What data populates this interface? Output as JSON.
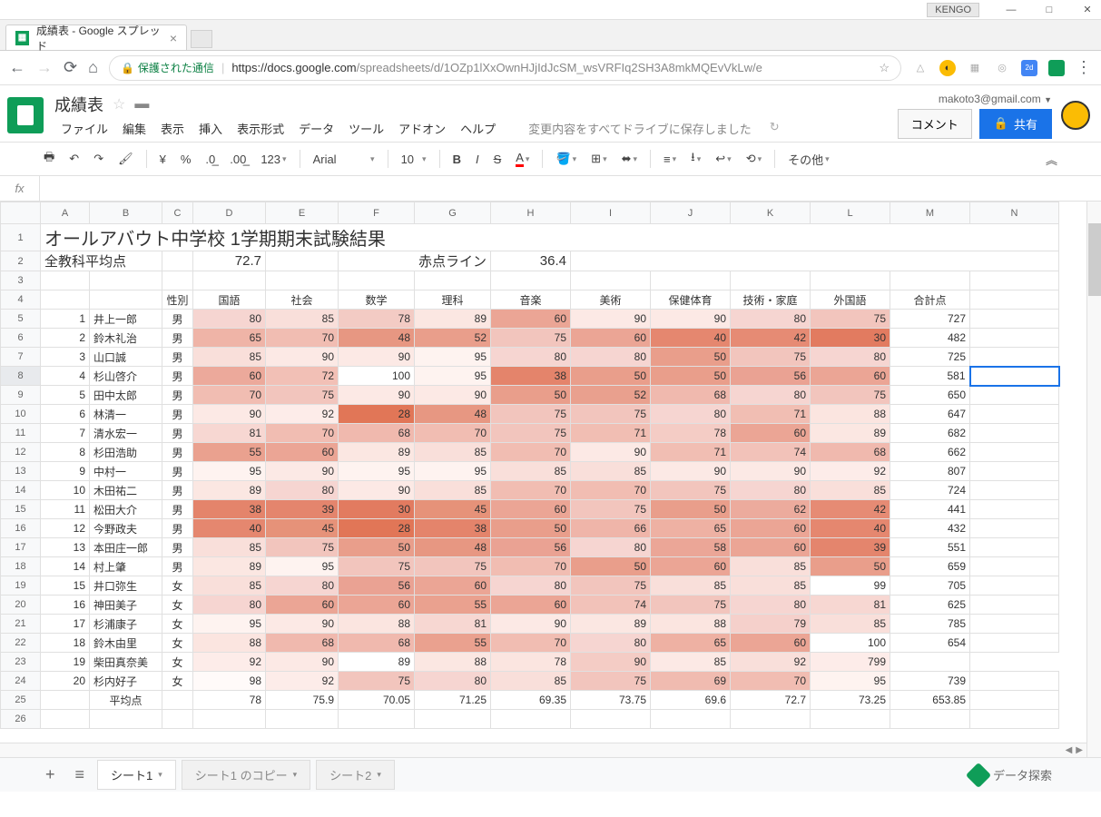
{
  "window": {
    "user": "KENGO"
  },
  "browser": {
    "tab_title": "成績表 - Google スプレッド",
    "secure_label": "保護された通信",
    "url_host": "https://docs.google.com",
    "url_path": "/spreadsheets/d/1OZp1lXxOwnHJjIdJcSM_wsVRFIq2SH3A8mkMQEvVkLw/e"
  },
  "doc": {
    "title": "成績表",
    "menus": [
      "ファイル",
      "編集",
      "表示",
      "挿入",
      "表示形式",
      "データ",
      "ツール",
      "アドオン",
      "ヘルプ"
    ],
    "save_status": "変更内容をすべてドライブに保存しました",
    "user_email": "makoto3@gmail.com",
    "comment_btn": "コメント",
    "share_btn": "共有"
  },
  "toolbar": {
    "font": "Arial",
    "size": "10",
    "other": "その他"
  },
  "sheet": {
    "main_title": "オールアバウト中学校 1学期期末試験結果",
    "avg_label": "全教科平均点",
    "avg_val": "72.7",
    "red_label": "赤点ライン",
    "red_val": "36.4",
    "gender_hdr": "性別",
    "cols": [
      "A",
      "B",
      "C",
      "D",
      "E",
      "F",
      "G",
      "H",
      "I",
      "J",
      "K",
      "L",
      "M",
      "N"
    ],
    "subjects": [
      "国語",
      "社会",
      "数学",
      "理科",
      "音楽",
      "美術",
      "保健体育",
      "技術・家庭",
      "外国語",
      "合計点"
    ],
    "avg_row_label": "平均点",
    "averages": [
      "78",
      "75.9",
      "70.05",
      "71.25",
      "69.35",
      "73.75",
      "69.6",
      "72.7",
      "73.25",
      "653.85"
    ],
    "rows": [
      {
        "n": 1,
        "name": "井上一郎",
        "g": "男",
        "s": [
          80,
          85,
          78,
          89,
          60,
          90,
          90,
          80,
          75,
          727
        ],
        "c": [
          "f6d5d1",
          "f9dfda",
          "f3cbc4",
          "fbe7e2",
          "eba595",
          "fce9e5",
          "fce9e5",
          "f6d5d1",
          "f2c5bd",
          ""
        ]
      },
      {
        "n": 2,
        "name": "鈴木礼治",
        "g": "男",
        "s": [
          65,
          70,
          48,
          52,
          75,
          60,
          40,
          42,
          30,
          482
        ],
        "c": [
          "efb4a7",
          "f1bdb2",
          "e79782",
          "e99e8b",
          "f2c5bd",
          "eba595",
          "e5876f",
          "e68b74",
          "e27b60",
          ""
        ]
      },
      {
        "n": 3,
        "name": "山口誠",
        "g": "男",
        "s": [
          85,
          90,
          90,
          95,
          80,
          80,
          50,
          75,
          80,
          725
        ],
        "c": [
          "f9dfda",
          "fce9e5",
          "fce9e5",
          "fef3f0",
          "f6d5d1",
          "f6d5d1",
          "e99e8b",
          "f2c5bd",
          "f6d5d1",
          ""
        ]
      },
      {
        "n": 4,
        "name": "杉山啓介",
        "g": "男",
        "s": [
          60,
          72,
          100,
          95,
          38,
          50,
          50,
          56,
          60,
          581
        ],
        "c": [
          "eca99b",
          "f2c0b6",
          "ffffff",
          "fef3f0",
          "e4846b",
          "e99e8b",
          "e99e8b",
          "eaa293",
          "eba595",
          ""
        ]
      },
      {
        "n": 5,
        "name": "田中太郎",
        "g": "男",
        "s": [
          70,
          75,
          90,
          90,
          50,
          52,
          68,
          80,
          75,
          650
        ],
        "c": [
          "f1bdb2",
          "f2c5bd",
          "fce9e5",
          "fce9e5",
          "e99e8b",
          "e9a08e",
          "f0b9ae",
          "f6d5d1",
          "f2c5bd",
          ""
        ]
      },
      {
        "n": 6,
        "name": "林清一",
        "g": "男",
        "s": [
          90,
          92,
          28,
          48,
          75,
          75,
          80,
          71,
          88,
          647
        ],
        "c": [
          "fce9e5",
          "fdece9",
          "e17657",
          "e79782",
          "f2c5bd",
          "f2c5bd",
          "f6d5d1",
          "f1beb3",
          "fbe5e0",
          ""
        ]
      },
      {
        "n": 7,
        "name": "清水宏一",
        "g": "男",
        "s": [
          81,
          70,
          68,
          70,
          75,
          71,
          78,
          60,
          89,
          682
        ],
        "c": [
          "f7d7d2",
          "f1bdb2",
          "f0b9ae",
          "f1bdb2",
          "f2c5bd",
          "f1beb3",
          "f4ccc5",
          "eba595",
          "fbe7e2",
          ""
        ]
      },
      {
        "n": 8,
        "name": "杉田浩助",
        "g": "男",
        "s": [
          55,
          60,
          89,
          85,
          70,
          90,
          71,
          74,
          68,
          662
        ],
        "c": [
          "eaa18f",
          "eba595",
          "fbe7e2",
          "f9dfda",
          "f1bdb2",
          "fce9e5",
          "f1beb3",
          "f2c2b9",
          "f0b9ae",
          ""
        ]
      },
      {
        "n": 9,
        "name": "中村一",
        "g": "男",
        "s": [
          95,
          90,
          95,
          95,
          85,
          85,
          90,
          90,
          92,
          807
        ],
        "c": [
          "fef3f0",
          "fce9e5",
          "fef3f0",
          "fef3f0",
          "f9dfda",
          "f9dfda",
          "fce9e5",
          "fce9e5",
          "fdece9",
          ""
        ]
      },
      {
        "n": 10,
        "name": "木田祐二",
        "g": "男",
        "s": [
          89,
          80,
          90,
          85,
          70,
          70,
          75,
          80,
          85,
          724
        ],
        "c": [
          "fbe7e2",
          "f6d5d1",
          "fce9e5",
          "f9dfda",
          "f1bdb2",
          "f1bdb2",
          "f2c5bd",
          "f6d5d1",
          "f9dfda",
          ""
        ]
      },
      {
        "n": 11,
        "name": "松田大介",
        "g": "男",
        "s": [
          38,
          39,
          30,
          45,
          60,
          75,
          50,
          62,
          42,
          441
        ],
        "c": [
          "e4846b",
          "e4856d",
          "e27b60",
          "e69279",
          "eba595",
          "f2c5bd",
          "e99e8b",
          "ecab9d",
          "e68b74",
          ""
        ]
      },
      {
        "n": 12,
        "name": "今野政夫",
        "g": "男",
        "s": [
          40,
          45,
          28,
          38,
          50,
          66,
          65,
          60,
          40,
          432
        ],
        "c": [
          "e5876f",
          "e69279",
          "e17657",
          "e4846b",
          "e99e8b",
          "efb5a9",
          "eeb1a3",
          "eba595",
          "e5876f",
          ""
        ]
      },
      {
        "n": 13,
        "name": "本田庄一郎",
        "g": "男",
        "s": [
          85,
          75,
          50,
          48,
          56,
          80,
          58,
          60,
          39,
          551
        ],
        "c": [
          "f9dfda",
          "f2c5bd",
          "e99e8b",
          "e79782",
          "eaa293",
          "f6d5d1",
          "eba697",
          "eba595",
          "e4856d",
          ""
        ]
      },
      {
        "n": 14,
        "name": "村上肇",
        "g": "男",
        "s": [
          89,
          95,
          75,
          75,
          70,
          50,
          60,
          85,
          50,
          659
        ],
        "c": [
          "fbe7e2",
          "fef3f0",
          "f2c5bd",
          "f2c5bd",
          "f1bdb2",
          "e99e8b",
          "eba595",
          "f9dfda",
          "e99e8b",
          ""
        ]
      },
      {
        "n": 15,
        "name": "井口弥生",
        "g": "女",
        "s": [
          85,
          80,
          56,
          60,
          80,
          75,
          85,
          85,
          99,
          705
        ],
        "c": [
          "f9dfda",
          "f6d5d1",
          "eaa293",
          "eba595",
          "f6d5d1",
          "f2c5bd",
          "f9dfda",
          "f9dfda",
          "ffffff",
          ""
        ]
      },
      {
        "n": 16,
        "name": "神田美子",
        "g": "女",
        "s": [
          80,
          60,
          60,
          55,
          60,
          74,
          75,
          80,
          81,
          625
        ],
        "c": [
          "f6d5d1",
          "eba595",
          "eba595",
          "eaa18f",
          "eba595",
          "f2c2b9",
          "f2c5bd",
          "f6d5d1",
          "f7d7d2",
          ""
        ]
      },
      {
        "n": 17,
        "name": "杉浦康子",
        "g": "女",
        "s": [
          95,
          90,
          88,
          81,
          90,
          89,
          88,
          79,
          85,
          785
        ],
        "c": [
          "fef3f0",
          "fce9e5",
          "fbe5e0",
          "f7d7d2",
          "fce9e5",
          "fbe7e2",
          "fbe5e0",
          "f5d0cb",
          "f9dfda",
          ""
        ]
      },
      {
        "n": 18,
        "name": "鈴木由里",
        "g": "女",
        "s": [
          88,
          68,
          68,
          55,
          70,
          80,
          65,
          60,
          100,
          654
        ],
        "c": [
          "fbe5e0",
          "f0b9ae",
          "f0b9ae",
          "eaa18f",
          "f1bdb2",
          "f6d5d1",
          "eeb1a3",
          "eba595",
          "ffffff",
          ""
        ]
      },
      {
        "n": 19,
        "name": "柴田真奈美",
        "g": "女",
        "s": [
          92,
          90,
          89,
          88,
          78,
          90,
          85,
          92,
          799
        ],
        "c": [
          "fdece9",
          "fce9e5",
          "ffffff",
          "fbe7e2",
          "fbe5e0",
          "f4ccc5",
          "fce9e5",
          "f9dfda",
          "fdece9",
          ""
        ],
        "s2": [
          92,
          90,
          "",
          89,
          88,
          78,
          90,
          85,
          92,
          799
        ]
      },
      {
        "n": 20,
        "name": "杉内好子",
        "g": "女",
        "s": [
          98,
          92,
          75,
          80,
          85,
          75,
          69,
          70,
          95,
          739
        ],
        "c": [
          "fffaf9",
          "fdece9",
          "f2c5bd",
          "f6d5d1",
          "f9dfda",
          "f2c5bd",
          "f0bbb0",
          "f1bdb2",
          "fef3f0",
          ""
        ]
      }
    ]
  },
  "tabs": {
    "add": "+",
    "list": "≡",
    "t1": "シート1",
    "t2": "シート1 のコピー",
    "t3": "シート2",
    "explore": "データ探索"
  }
}
